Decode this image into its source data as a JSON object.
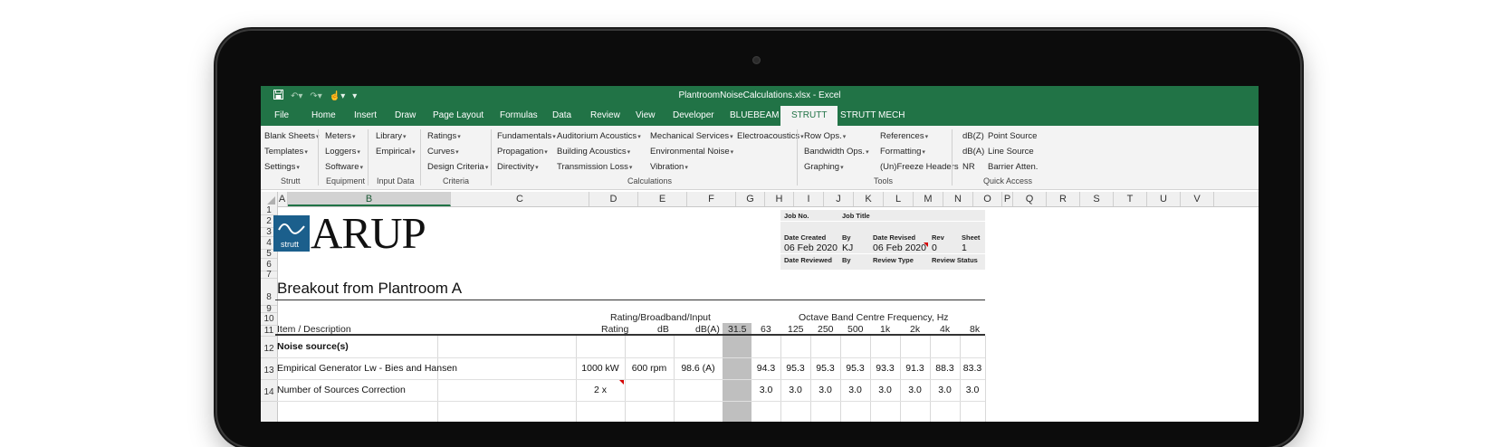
{
  "window": {
    "title": "PlantroomNoiseCalculations.xlsx  -  Excel",
    "qat": {
      "save_icon": "save-icon",
      "undo_icon": "undo-icon",
      "redo_icon": "redo-icon",
      "touch_icon": "touch-mode-icon",
      "customize_icon": "customize-icon"
    }
  },
  "tabs": [
    "File",
    "Home",
    "Insert",
    "Draw",
    "Page Layout",
    "Formulas",
    "Data",
    "Review",
    "View",
    "Developer",
    "BLUEBEAM",
    "STRUTT",
    "STRUTT MECH"
  ],
  "active_tab": "STRUTT",
  "ribbon": {
    "strutt": {
      "items": [
        "Blank Sheets",
        "Templates",
        "Settings"
      ],
      "label": "Strutt"
    },
    "equipment": {
      "items": [
        "Meters",
        "Loggers",
        "Software"
      ],
      "label": "Equipment"
    },
    "input_data": {
      "items": [
        "Library",
        "Empirical"
      ],
      "label": "Input Data"
    },
    "criteria": {
      "items": [
        "Ratings",
        "Curves",
        "Design Criteria"
      ],
      "label": "Criteria"
    },
    "calculations": {
      "col1": [
        "Fundamentals",
        "Propagation",
        "Directivity"
      ],
      "col2": [
        "Auditorium Acoustics",
        "Building Acoustics",
        "Transmission Loss"
      ],
      "col3": [
        "Mechanical Services",
        "Environmental Noise",
        "Vibration"
      ],
      "col4": [
        "Electroacoustics"
      ],
      "label": "Calculations"
    },
    "tools": {
      "col1": [
        "Row Ops.",
        "Bandwidth Ops.",
        "Graphing"
      ],
      "col2": [
        "References",
        "Formatting",
        "(Un)Freeze Headers"
      ],
      "label": "Tools"
    },
    "quick_access": {
      "col1": [
        "dB(Z)",
        "dB(A)",
        "NR"
      ],
      "col2": [
        "Point Source",
        "Line Source",
        "Barrier Atten."
      ],
      "label": "Quick Access"
    }
  },
  "columns": [
    "A",
    "B",
    "C",
    "D",
    "E",
    "F",
    "G",
    "H",
    "I",
    "J",
    "K",
    "L",
    "M",
    "N",
    "O",
    "P",
    "Q",
    "R",
    "S",
    "T",
    "U",
    "V"
  ],
  "rows": [
    "1",
    "2",
    "3",
    "4",
    "5",
    "6",
    "7",
    "8",
    "9",
    "10",
    "11",
    "12",
    "13",
    "14"
  ],
  "logo": {
    "strutt_text": "strutt",
    "company": "ARUP"
  },
  "info": {
    "job_no_label": "Job No.",
    "job_title_label": "Job Title",
    "date_created_label": "Date Created",
    "by_label": "By",
    "date_revised_label": "Date Revised",
    "rev_label": "Rev",
    "sheet_label": "Sheet",
    "date_created": "06 Feb 2020",
    "by": "KJ",
    "date_revised": "06 Feb 2020",
    "rev": "0",
    "sheet": "1",
    "date_reviewed_label": "Date Reviewed",
    "by2_label": "By",
    "review_type_label": "Review Type",
    "review_status_label": "Review Status"
  },
  "sheet": {
    "title": "Breakout from Plantroom A",
    "rating_group": "Rating/Broadband/Input",
    "octave_group": "Octave Band Centre Frequency, Hz",
    "item_header": "Item / Description",
    "rating_header": "Rating",
    "db_header": "dB",
    "dba_header": "dB(A)",
    "bands": [
      "31.5",
      "63",
      "125",
      "250",
      "500",
      "1k",
      "2k",
      "4k",
      "8k"
    ],
    "section": "Noise source(s)",
    "row13": {
      "desc": "Empirical Generator Lw - Bies and Hansen",
      "rating": "1000 kW",
      "db": "600 rpm",
      "dba": "98.6 (A)",
      "values": [
        "94.3",
        "95.3",
        "95.3",
        "95.3",
        "93.3",
        "91.3",
        "88.3",
        "83.3"
      ]
    },
    "row14": {
      "desc": "Number of Sources Correction",
      "rating": "2 x",
      "values": [
        "3.0",
        "3.0",
        "3.0",
        "3.0",
        "3.0",
        "3.0",
        "3.0",
        "3.0"
      ]
    }
  }
}
